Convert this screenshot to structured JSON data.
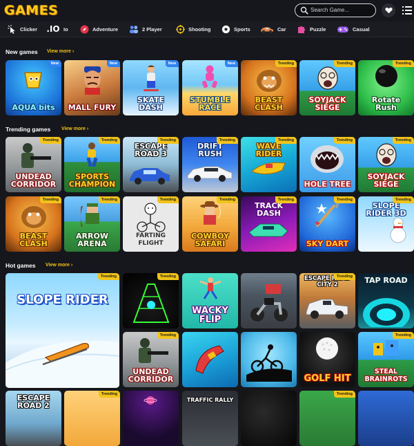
{
  "brand": {
    "logo_text": "GAMES"
  },
  "search": {
    "placeholder": "Search Game..."
  },
  "icons": {
    "search": "search-icon",
    "favorites": "heart-icon",
    "menu": "list-menu-icon"
  },
  "categories": [
    {
      "label": "Clicker",
      "icon": "cursor-click-icon"
    },
    {
      "label": "Io",
      "icon": "io-icon"
    },
    {
      "label": "Adventure",
      "icon": "compass-icon"
    },
    {
      "label": "2 Player",
      "icon": "two-players-icon"
    },
    {
      "label": "Shooting",
      "icon": "crosshair-icon"
    },
    {
      "label": "Sports",
      "icon": "soccer-ball-icon"
    },
    {
      "label": "Car",
      "icon": "car-icon"
    },
    {
      "label": "Puzzle",
      "icon": "puzzle-piece-icon"
    },
    {
      "label": "Casual",
      "icon": "gamepad-icon"
    }
  ],
  "sections": {
    "new": {
      "title": "New games",
      "view_more": "View more ›",
      "games": [
        {
          "name": "AQUA bits",
          "badge": "New"
        },
        {
          "name": "MALL FURY",
          "badge": "New"
        },
        {
          "name": "SKATE DASH",
          "badge": "New"
        },
        {
          "name": "STUMBLE RACE",
          "badge": "New"
        },
        {
          "name": "BEAST CLASH",
          "badge": "Trending"
        },
        {
          "name": "SOYJACK SIEGE",
          "badge": "Trending"
        },
        {
          "name": "Rotate Rush",
          "badge": "Trending"
        }
      ]
    },
    "trending": {
      "title": "Trending games",
      "view_more": "View more ›",
      "games": [
        {
          "name": "UNDEAD CORRIDOR",
          "badge": "Trending"
        },
        {
          "name": "SPORTS CHAMPION",
          "badge": "Trending"
        },
        {
          "name": "ESCAPE ROAD 3",
          "badge": "Trending"
        },
        {
          "name": "DRIFT RUSH",
          "badge": "Trending"
        },
        {
          "name": "WAVE RIDER",
          "badge": "Trending"
        },
        {
          "name": "HOLE TREE",
          "badge": "Trending"
        },
        {
          "name": "SOYJACK SIEGE",
          "badge": "Trending"
        },
        {
          "name": "BEAST CLASH",
          "badge": "Trending"
        },
        {
          "name": "ARROW ARENA",
          "badge": "Trending"
        },
        {
          "name": "FARTING FLIGHT",
          "badge": "Trending"
        },
        {
          "name": "COWBOY SAFARI",
          "badge": "Trending"
        },
        {
          "name": "TRACK DASH",
          "badge": "Trending"
        },
        {
          "name": "SKY DART",
          "badge": "Trending"
        },
        {
          "name": "SLOPE RIDER 3D",
          "badge": "Trending"
        }
      ]
    },
    "hot": {
      "title": "Hot games",
      "view_more": "View more ›",
      "games": [
        {
          "name": "SLOPE RIDER",
          "badge": "Trending"
        },
        {
          "name": "",
          "badge": "Trending"
        },
        {
          "name": "WACKY FLIP",
          "badge": ""
        },
        {
          "name": "",
          "badge": ""
        },
        {
          "name": "ESCAPE ROAD CITY 2",
          "badge": "Trending"
        },
        {
          "name": "TAP ROAD",
          "badge": ""
        },
        {
          "name": "UNDEAD CORRIDOR",
          "badge": "Trending"
        },
        {
          "name": "",
          "badge": ""
        },
        {
          "name": "",
          "badge": ""
        },
        {
          "name": "GOLF HIT",
          "badge": ""
        },
        {
          "name": "STEAL BRAINROTS",
          "badge": "Trending"
        },
        {
          "name": "ESCAPE ROAD 2",
          "badge": ""
        },
        {
          "name": "",
          "badge": "Trending"
        },
        {
          "name": "",
          "badge": ""
        },
        {
          "name": "TRAFFIC RALLY",
          "badge": ""
        },
        {
          "name": "",
          "badge": ""
        },
        {
          "name": "",
          "badge": "Trending"
        },
        {
          "name": "",
          "badge": ""
        }
      ]
    }
  },
  "colors": {
    "background": "#16171d",
    "accent": "#f2c318",
    "new_badge": "#2f84f2",
    "trending_badge": "#f2c318"
  }
}
